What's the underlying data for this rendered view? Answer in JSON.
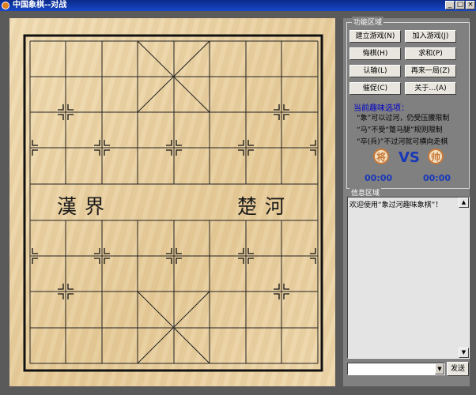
{
  "window": {
    "title": "中国象棋--对战",
    "minimize": "_",
    "maximize": "□",
    "close": "×"
  },
  "board": {
    "river_left": "漢界",
    "river_right": "楚河"
  },
  "function_area": {
    "title": "功能区域",
    "buttons": [
      "建立游戏(N)",
      "加入游戏(J)",
      "悔棋(H)",
      "求和(P)",
      "认输(L)",
      "再来一局(Z)",
      "催促(C)",
      "关于…(A)"
    ]
  },
  "options": {
    "title": "当前趣味选项：",
    "lines": [
      "“象”可以过河，仍受压腰限制",
      "“马”不受“蹩马腿”规则限制",
      "“卒(兵)”不过河就可横向走棋"
    ]
  },
  "players": {
    "left_piece": "将",
    "right_piece": "帅",
    "vs": "VS",
    "left_time": "00:00",
    "right_time": "00:00"
  },
  "info_area": {
    "title": "信息区域",
    "message": "欢迎使用“象过河趣味象棋”！",
    "scroll_up": "▲",
    "scroll_down": "▼"
  },
  "input": {
    "send_label": "发送",
    "dropdown_arrow": "▼"
  },
  "colors": {
    "title_bar": "#0a2a8a",
    "panel": "#808080",
    "accent_blue": "#1838b8",
    "piece": "#c87838",
    "board": "#ecd6a8"
  }
}
